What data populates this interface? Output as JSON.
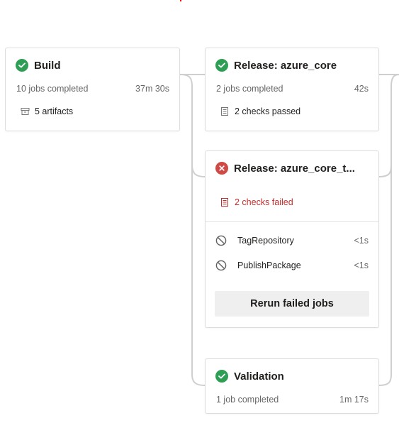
{
  "stages": {
    "build": {
      "title": "Build",
      "status": "succeeded",
      "jobs": "10 jobs completed",
      "duration": "37m 30s",
      "artifacts": "5 artifacts"
    },
    "release_core": {
      "title": "Release: azure_core",
      "status": "succeeded",
      "jobs": "2 jobs completed",
      "duration": "42s",
      "checks": "2 checks passed"
    },
    "release_core_t": {
      "title": "Release: azure_core_t...",
      "status": "failed",
      "checks": "2 checks failed",
      "jobs": [
        {
          "name": "TagRepository",
          "duration": "<1s",
          "icon": "skipped-icon"
        },
        {
          "name": "PublishPackage",
          "duration": "<1s",
          "icon": "skipped-icon"
        }
      ],
      "rerun_label": "Rerun failed jobs"
    },
    "validation": {
      "title": "Validation",
      "status": "succeeded",
      "jobs": "1 job completed",
      "duration": "1m 17s"
    }
  },
  "colors": {
    "success": "#2f9e55",
    "failed": "#cd4a45",
    "failed_text": "#c62b2b",
    "connector": "#cfcfcf",
    "border": "#dddddd",
    "button_bg": "#efefef"
  },
  "icons": {
    "success": "check-circle-icon",
    "failed": "x-circle-icon",
    "artifact": "artifact-icon",
    "checks": "checklist-icon",
    "skipped": "skipped-icon"
  }
}
